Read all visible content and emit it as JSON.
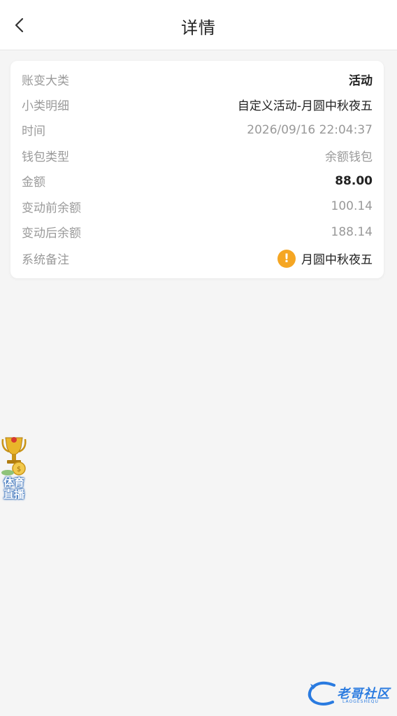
{
  "header": {
    "title": "详情",
    "back_icon": "chevron-left-icon"
  },
  "details": {
    "rows": [
      {
        "label": "账变大类",
        "value": "活动"
      },
      {
        "label": "小类明细",
        "value": "自定义活动-月圆中秋夜五"
      },
      {
        "label": "时间",
        "value": "2026/09/16 22:04:37"
      },
      {
        "label": "钱包类型",
        "value": "余额钱包"
      },
      {
        "label": "金额",
        "value": "88.00"
      },
      {
        "label": "变动前余额",
        "value": "100.14"
      },
      {
        "label": "变动后余额",
        "value": "188.14"
      }
    ],
    "remark": {
      "label": "系统备注",
      "value": "月圆中秋夜五",
      "icon": "warning-icon",
      "icon_glyph": "!",
      "icon_color": "#f5a623"
    }
  },
  "floating": {
    "sports_label": "体育直播",
    "icon": "trophy-icon"
  },
  "watermark": {
    "text": "老哥社区",
    "sub": "LAOGESHEQU"
  },
  "colors": {
    "background": "#f5f5f5",
    "label": "#9a9a9a",
    "value_dark": "#222222",
    "value_gray": "#999999",
    "warning": "#f5a623",
    "watermark": "#2a7be0"
  }
}
